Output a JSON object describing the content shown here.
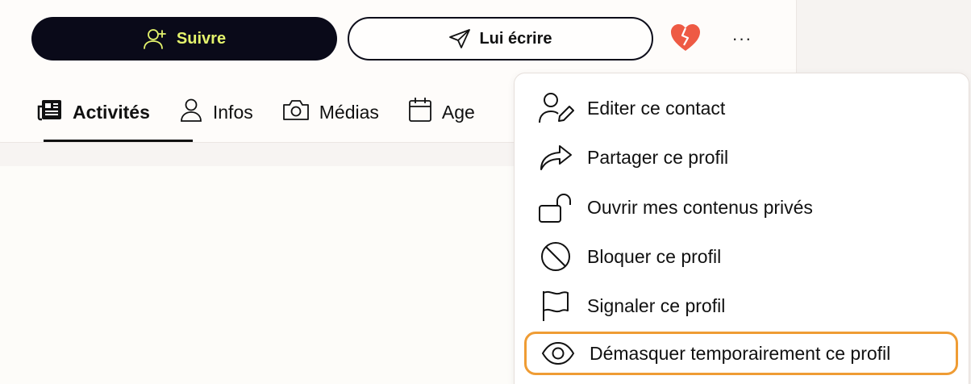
{
  "actions": {
    "follow_label": "Suivre",
    "message_label": "Lui écrire",
    "more_label": "···"
  },
  "tabs": [
    {
      "label": "Activités",
      "icon": "newspaper-icon",
      "active": true
    },
    {
      "label": "Infos",
      "icon": "user-icon",
      "active": false
    },
    {
      "label": "Médias",
      "icon": "camera-icon",
      "active": false
    },
    {
      "label": "Age",
      "icon": "calendar-icon",
      "active": false
    }
  ],
  "menu": {
    "items": [
      {
        "label": "Editer ce contact",
        "icon": "edit-contact-icon"
      },
      {
        "label": "Partager ce profil",
        "icon": "share-icon"
      },
      {
        "label": "Ouvrir mes contenus privés",
        "icon": "unlock-icon"
      },
      {
        "label": "Bloquer ce profil",
        "icon": "block-icon"
      },
      {
        "label": "Signaler ce profil",
        "icon": "flag-icon"
      },
      {
        "label": "Démasquer temporairement ce profil",
        "icon": "eye-icon"
      }
    ]
  },
  "colors": {
    "follow_bg": "#0a0a19",
    "follow_text": "#e4f36c",
    "heart": "#ee5a44",
    "focus_ring": "#ef9c34"
  }
}
